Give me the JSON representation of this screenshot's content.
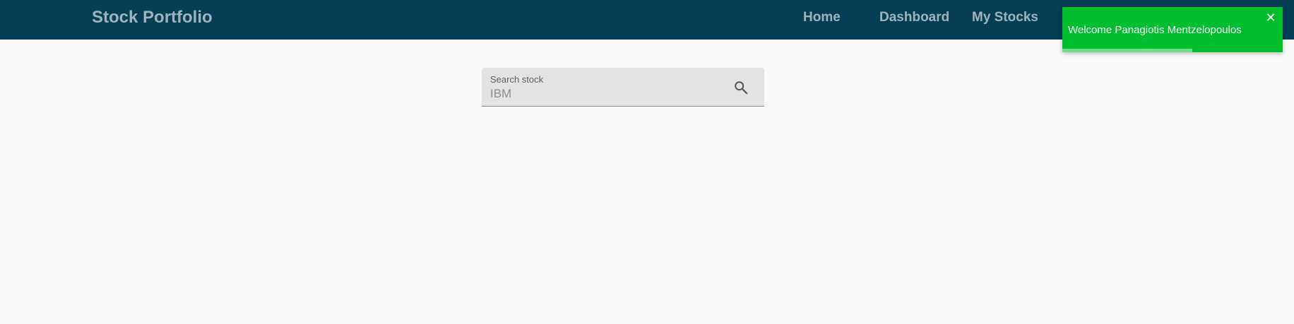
{
  "navbar": {
    "brand": "Stock Portfolio",
    "links": [
      "Home",
      "Dashboard",
      "My Stocks"
    ],
    "background_color": "#063e55"
  },
  "search": {
    "label": "Search stock",
    "placeholder": "IBM",
    "icon": "search-icon"
  },
  "toast": {
    "message": "Welcome Panagiotis Mentzelopoulos",
    "close_icon": "close-icon",
    "progress_fraction": 0.59,
    "background_color": "#00bf2f"
  }
}
